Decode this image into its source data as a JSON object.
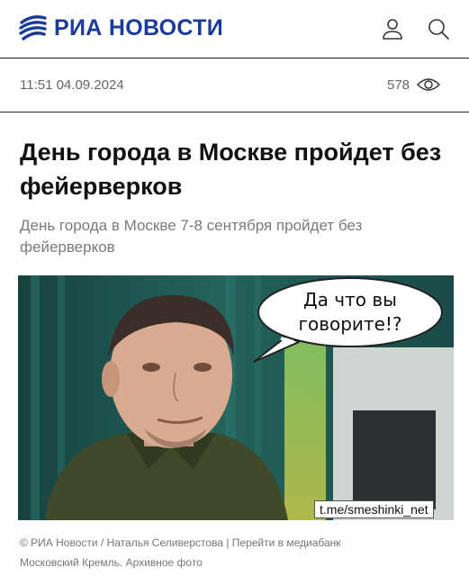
{
  "header": {
    "logo_text": "РИА НОВОСТИ",
    "logo_icon": "ria-globe-icon",
    "profile_icon": "user-icon",
    "search_icon": "search-icon",
    "brand_color": "#1b3b9c"
  },
  "meta": {
    "datetime": "11:51 04.09.2024",
    "views": "578",
    "views_icon": "eye-icon"
  },
  "article": {
    "title": "День города в Москве пройдет без фейерверков",
    "lead": "День города в Москве 7-8 сентября пройдет без фейерверков"
  },
  "photo": {
    "speech_line1": "Да что вы",
    "speech_line2": "говорите!?",
    "watermark": "t.me/smeshinki_net"
  },
  "credits": {
    "source": "© РИА Новости / Наталья Селиверстова |",
    "media_link": "Перейти в медиабанк",
    "caption": "Московский Кремль. Архивное фото"
  }
}
